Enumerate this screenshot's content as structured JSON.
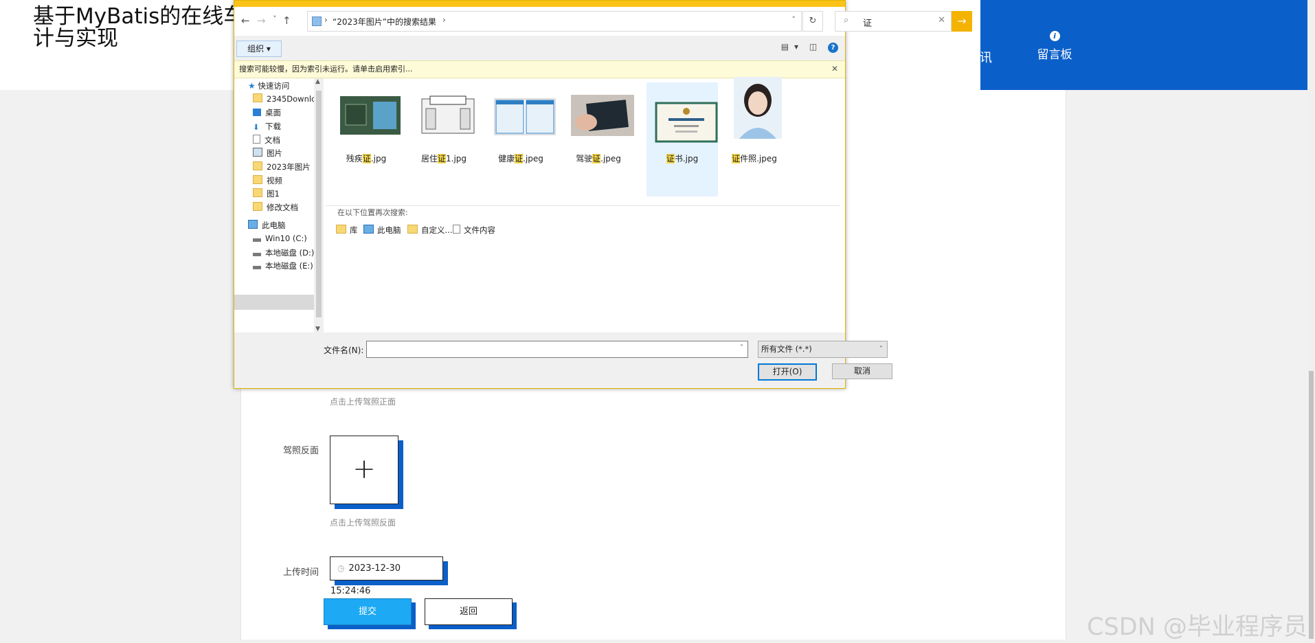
{
  "site": {
    "title": "基于MyBatis的在线车",
    "title_line2": "计与实现",
    "nav_partial": "讯",
    "nav_message_board": "留言板",
    "nav_message_icon": "i"
  },
  "form": {
    "front_hint": "点击上传驾照正面",
    "back_label": "驾照反面",
    "back_upload_symbol": "+",
    "back_hint": "点击上传驾照反面",
    "upload_time_label": "上传时间",
    "upload_time_value": "2023-12-30 15:24:46",
    "submit_label": "提交",
    "back_button_label": "返回"
  },
  "watermark": "CSDN @毕业程序员",
  "dialog": {
    "nav": {
      "back": "←",
      "forward": "→",
      "recent": "˅",
      "up": "↑"
    },
    "address_path": "“2023年图片”中的搜索结果",
    "address_sep": "›",
    "address_drop": "˅",
    "refresh": "↻",
    "search_value": "证",
    "search_icon": "⌕",
    "search_clear": "✕",
    "search_go": "→",
    "organize_label": "组织 ▾",
    "view_icons": [
      "▤",
      "▾",
      "◫"
    ],
    "help": "?",
    "info_message": "搜索可能较慢，因为索引未运行。请单击启用索引...",
    "info_close": "✕",
    "nav_items": [
      {
        "label": "快速访问",
        "icon": "star-icon"
      },
      {
        "label": "2345Downlc",
        "icon": "folder-icon",
        "pinned": true
      },
      {
        "label": "桌面",
        "icon": "desktop-icon",
        "pinned": true
      },
      {
        "label": "下载",
        "icon": "download-icon",
        "pinned": true
      },
      {
        "label": "文档",
        "icon": "document-icon",
        "pinned": true
      },
      {
        "label": "图片",
        "icon": "pictures-icon",
        "pinned": true
      },
      {
        "label": "2023年图片",
        "icon": "folder-icon"
      },
      {
        "label": "视频",
        "icon": "folder-icon"
      },
      {
        "label": "图1",
        "icon": "folder-icon"
      },
      {
        "label": "修改文档",
        "icon": "folder-icon"
      },
      {
        "label": "此电脑",
        "icon": "computer-icon"
      },
      {
        "label": "Win10 (C:)",
        "icon": "drive-icon"
      },
      {
        "label": "本地磁盘 (D:)",
        "icon": "drive-icon",
        "selected": true
      },
      {
        "label": "本地磁盘 (E:)",
        "icon": "drive-icon"
      }
    ],
    "pin_glyph": "📌",
    "files": [
      {
        "pre": "残疾",
        "hl": "证",
        "post": ".jpg"
      },
      {
        "pre": "居住",
        "hl": "证",
        "post": "1.jpg"
      },
      {
        "pre": "健康",
        "hl": "证",
        "post": ".jpeg"
      },
      {
        "pre": "驾驶",
        "hl": "证",
        "post": ".jpeg"
      },
      {
        "pre": "",
        "hl": "证",
        "post": "书.jpg",
        "selected": true
      },
      {
        "pre": "",
        "hl": "证",
        "post": "件照.jpeg"
      }
    ],
    "research_label": "在以下位置再次搜索:",
    "research_items": [
      "库",
      "此电脑",
      "自定义...",
      "文件内容"
    ],
    "filename_label": "文件名(N):",
    "filename_value": "",
    "filter_value": "所有文件 (*.*)",
    "open_label": "打开(O)",
    "cancel_label": "取消"
  }
}
